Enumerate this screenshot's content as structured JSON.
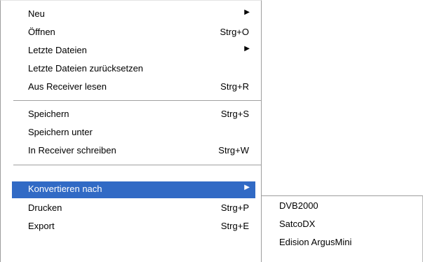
{
  "menu": {
    "items": [
      {
        "label": "Neu",
        "shortcut": "",
        "submenu": true
      },
      {
        "label": "Öffnen",
        "shortcut": "Strg+O",
        "submenu": false
      },
      {
        "label": "Letzte Dateien",
        "shortcut": "",
        "submenu": true
      },
      {
        "label": "Letzte Dateien zurücksetzen",
        "shortcut": "",
        "submenu": false
      },
      {
        "label": "Aus Receiver lesen",
        "shortcut": "Strg+R",
        "submenu": false
      },
      {
        "label": "Speichern",
        "shortcut": "Strg+S",
        "submenu": false
      },
      {
        "label": "Speichern unter",
        "shortcut": "",
        "submenu": false
      },
      {
        "label": "In Receiver schreiben",
        "shortcut": "Strg+W",
        "submenu": false
      },
      {
        "label": "Konvertieren nach",
        "shortcut": "",
        "submenu": true,
        "selected": true
      },
      {
        "label": "Drucken",
        "shortcut": "Strg+P",
        "submenu": false
      },
      {
        "label": "Export",
        "shortcut": "Strg+E",
        "submenu": false
      }
    ],
    "arrow_glyph": "▶"
  },
  "submenu": {
    "items": [
      {
        "label": "DVB2000"
      },
      {
        "label": "SatcoDX"
      },
      {
        "label": "Edision ArgusMini"
      }
    ]
  },
  "colors": {
    "selection": "#316ac5",
    "separator": "#a0a0a0"
  }
}
